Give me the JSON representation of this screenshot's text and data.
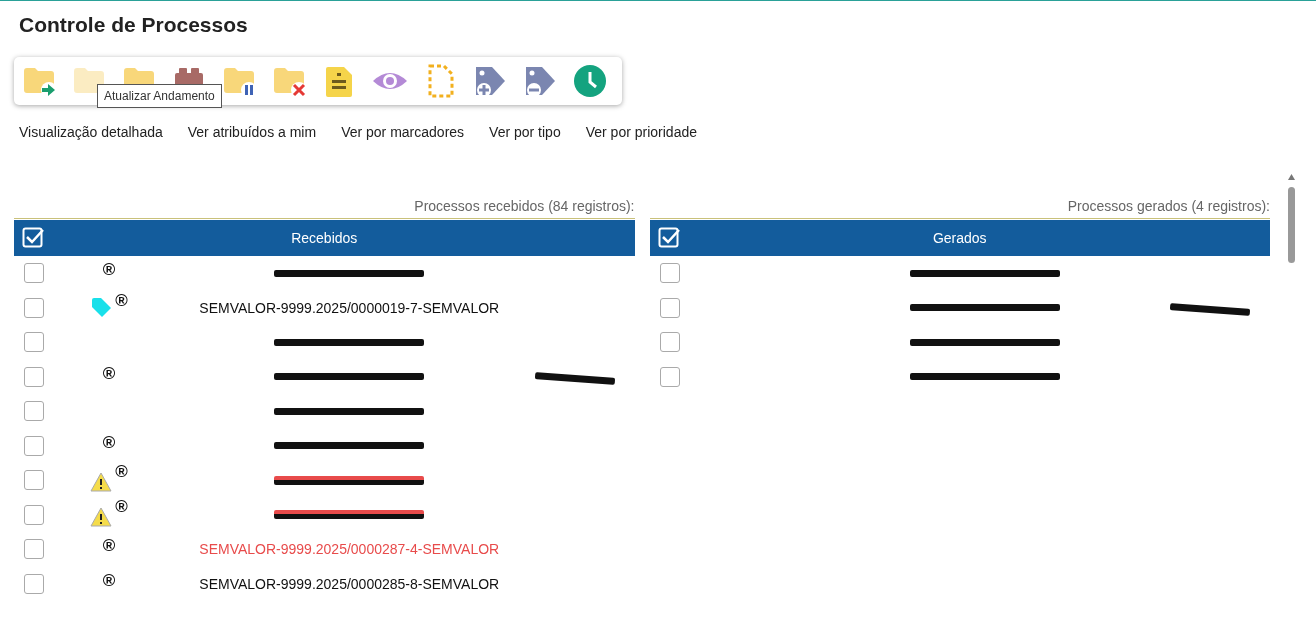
{
  "title": "Controle de Processos",
  "toolbar": [
    {
      "kind": "folder-send",
      "disabled": false
    },
    {
      "kind": "folder",
      "disabled": true
    },
    {
      "kind": "folder",
      "disabled": false
    },
    {
      "kind": "brick",
      "disabled": false
    },
    {
      "kind": "folder-pause",
      "disabled": false
    },
    {
      "kind": "folder-remove",
      "disabled": false
    },
    {
      "kind": "note",
      "disabled": false
    },
    {
      "kind": "eye",
      "disabled": false
    },
    {
      "kind": "dashed-doc",
      "disabled": false
    },
    {
      "kind": "tag-plus",
      "disabled": false
    },
    {
      "kind": "tag-minus",
      "disabled": false
    },
    {
      "kind": "clock",
      "disabled": false
    }
  ],
  "tooltip": {
    "text": "Atualizar Andamento"
  },
  "view_links": [
    "Visualização detalhada",
    "Ver atribuídos a mim",
    "Ver por marcadores",
    "Ver por tipo",
    "Ver por prioridade"
  ],
  "tables": [
    {
      "caption": "Processos recebidos (84 registros):",
      "header": "Recebidos",
      "select_all": true,
      "rows": [
        {
          "checked": false,
          "tag": false,
          "warning": false,
          "mark": "®",
          "redacted": true,
          "alert": false,
          "note_redacted": false
        },
        {
          "checked": false,
          "tag": true,
          "warning": false,
          "mark": "®",
          "number": "SEMVALOR-9999.2025/0000019-7-SEMVALOR",
          "redacted": false,
          "alert": false,
          "note_redacted": false
        },
        {
          "checked": false,
          "tag": false,
          "warning": false,
          "redacted": true,
          "alert": false,
          "note_redacted": false
        },
        {
          "checked": false,
          "tag": false,
          "warning": false,
          "mark": "®",
          "redacted": true,
          "alert": false,
          "note_redacted": true
        },
        {
          "checked": false,
          "tag": false,
          "warning": false,
          "redacted": true,
          "alert": false,
          "note_redacted": false
        },
        {
          "checked": false,
          "tag": false,
          "warning": false,
          "mark": "®",
          "redacted": true,
          "alert": false,
          "note_redacted": false
        },
        {
          "checked": false,
          "tag": false,
          "warning": true,
          "mark": "®",
          "redacted": true,
          "alert": true,
          "note_redacted": false
        },
        {
          "checked": false,
          "tag": false,
          "warning": true,
          "mark": "®",
          "redacted": true,
          "alert": true,
          "note_redacted": false
        },
        {
          "checked": false,
          "tag": false,
          "warning": false,
          "mark": "®",
          "number": "SEMVALOR-9999.2025/0000287-4-SEMVALOR",
          "redacted": false,
          "alert": true,
          "note_redacted": false
        },
        {
          "checked": false,
          "tag": false,
          "warning": false,
          "mark": "®",
          "number": "SEMVALOR-9999.2025/0000285-8-SEMVALOR",
          "redacted": false,
          "alert": false,
          "note_redacted": false
        }
      ]
    },
    {
      "caption": "Processos gerados (4 registros):",
      "header": "Gerados",
      "select_all": true,
      "rows": [
        {
          "checked": false,
          "tag": false,
          "warning": false,
          "redacted": true,
          "alert": false,
          "note_redacted": false
        },
        {
          "checked": false,
          "tag": false,
          "warning": false,
          "redacted": true,
          "alert": false,
          "note_redacted": true
        },
        {
          "checked": false,
          "tag": false,
          "warning": false,
          "redacted": true,
          "alert": false,
          "note_redacted": false
        },
        {
          "checked": false,
          "tag": false,
          "warning": false,
          "redacted": true,
          "alert": false,
          "note_redacted": false
        }
      ]
    }
  ]
}
